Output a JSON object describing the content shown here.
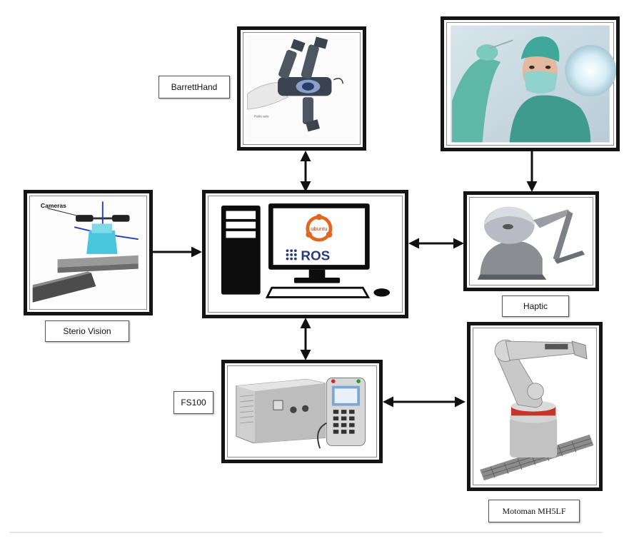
{
  "labels": {
    "barrett": "BarrettHand",
    "stereo": "Sterio Vision",
    "haptic": "Haptic",
    "fs100": "FS100",
    "motoman": "Motoman MH5LF",
    "cameras": "Cameras",
    "ros": "ROS",
    "ubuntu": "ubuntu"
  },
  "icons": [
    "barrett-hand-image",
    "surgeon-image",
    "stereo-vision-camera-rig",
    "computer-ros-workstation",
    "haptic-device-image",
    "fs100-controller-image",
    "motoman-robot-arm-image"
  ]
}
